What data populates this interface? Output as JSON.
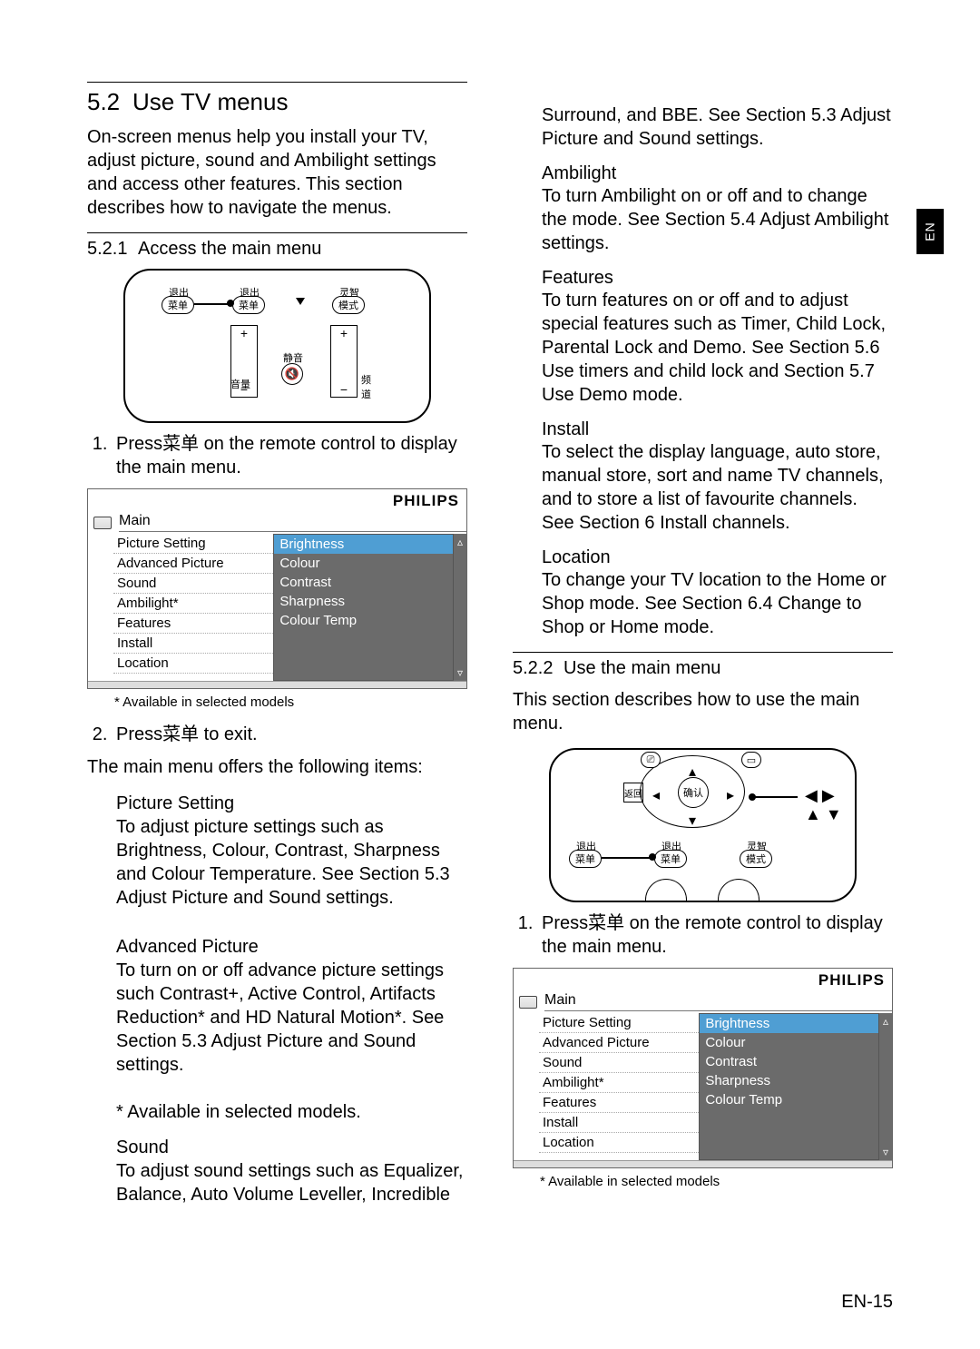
{
  "page_tab": "EN",
  "page_number": "EN-15",
  "left": {
    "section_num": "5.2",
    "section_title": "Use TV menus",
    "intro": "On-screen menus help you install your TV, adjust picture, sound and Ambilight settings and access other features. This section describes how to navigate the menus.",
    "sub_num": "5.2.1",
    "sub_title": "Access the main menu",
    "step1_prefix": "Press",
    "step1_cjk": "菜单",
    "step1_suffix": " on the remote control to display the main menu.",
    "step2_prefix": "Press",
    "step2_cjk": "菜单",
    "step2_suffix": " to exit.",
    "menu_brand": "PHILIPS",
    "menu_title": "Main",
    "menu_left": [
      "Picture Setting",
      "Advanced Picture",
      "Sound",
      "Ambilight*",
      "Features",
      "Install",
      "Location"
    ],
    "menu_right": [
      "Brightness",
      "Colour",
      "Contrast",
      "Sharpness",
      "Colour Temp"
    ],
    "footnote": "* Available in selected models",
    "offer_intro": "The main menu offers the following items:",
    "items": [
      {
        "title": "Picture Setting",
        "body_pre": "To adjust picture settings such as Brightness, Colour, Contrast, Sharpness and Colour Temperature. See",
        "body_post": "Section 5.3 Adjust Picture and Sound settings",
        "body_dot": "."
      },
      {
        "title": "Advanced Picture",
        "body": "To turn on or off advance picture settings such Contrast+, Active Control, Artifacts Reduction* and HD Natural Motion*. See Section 5.3 Adjust Picture and Sound settings."
      }
    ],
    "star_note": "* Available in selected models.",
    "sound_title": "Sound",
    "sound_body": "To adjust sound settings such as Equalizer, Balance, Auto Volume Leveller, Incredible",
    "remote_labels": {
      "exit1": "退出",
      "menu1": "菜单",
      "exit2": "退出",
      "menu2": "菜单",
      "mode": "灵智",
      "mode2": "模式",
      "mute_lbl": "静音",
      "vol_lbl": "音量",
      "ch_lbl": "频道",
      "plus": "+",
      "minus": "−"
    }
  },
  "right": {
    "cont_body": "Surround, and BBE. See Section 5.3 Adjust Picture and Sound settings.",
    "items": [
      {
        "title": "Ambilight",
        "body": "To turn Ambilight on or off and to change the mode. See Section 5.4 Adjust Ambilight settings."
      },
      {
        "title": "Features",
        "body": "To turn features on or off and to adjust special features such as Timer, Child Lock, Parental Lock and Demo. See Section 5.6 Use timers and child lock and Section 5.7 Use Demo mode."
      },
      {
        "title": "Install",
        "body": "To select the display language, auto store, manual store, sort and name TV channels, and to store a list of favourite channels. See Section 6 Install channels."
      },
      {
        "title": "Location",
        "body": "To change your TV location to the Home or Shop mode. See Section 6.4 Change to Shop or Home mode."
      }
    ],
    "sub2_num": "5.2.2",
    "sub2_title": "Use the main menu",
    "sub2_intro": "This section describes how to use the main menu.",
    "step1_prefix": "Press",
    "step1_cjk": "菜单",
    "step1_suffix": " on the remote control to display the main menu.",
    "menu_brand": "PHILIPS",
    "menu_title": "Main",
    "menu_left": [
      "Picture Setting",
      "Advanced Picture",
      "Sound",
      "Ambilight*",
      "Features",
      "Install",
      "Location"
    ],
    "menu_right": [
      "Brightness",
      "Colour",
      "Contrast",
      "Sharpness",
      "Colour Temp"
    ],
    "footnote": "* Available in selected models",
    "remote2_labels": {
      "back_lbl": "返回",
      "ok": "确认",
      "exit": "退出",
      "menu": "菜单",
      "mode": "灵智",
      "mode2": "模式",
      "arrows": "◀ ▶ ▲ ▼"
    }
  }
}
